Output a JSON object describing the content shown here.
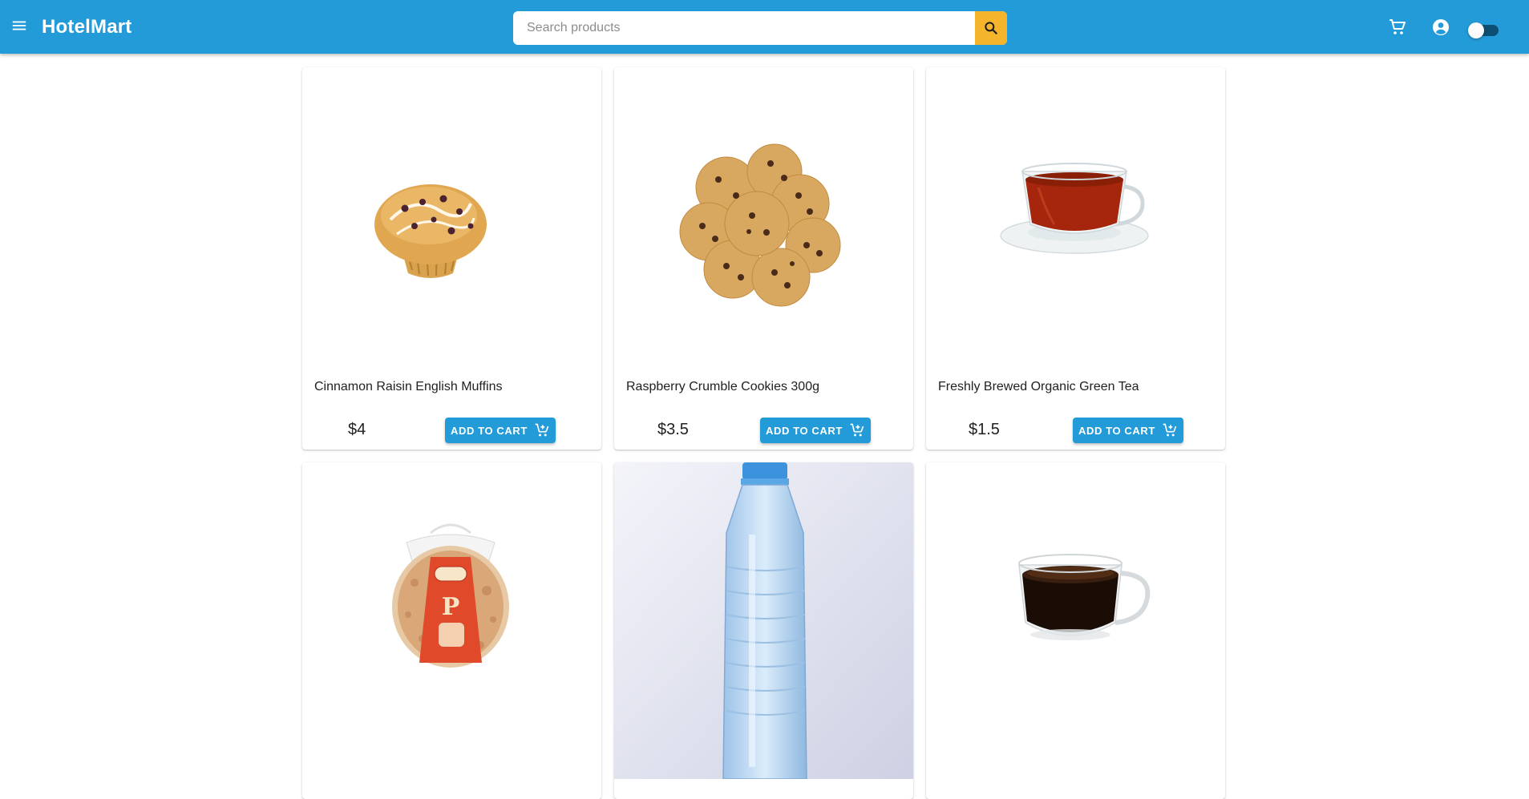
{
  "app": {
    "title": "HotelMart",
    "brand_color": "#229bd8",
    "accent_color": "#f4b52d"
  },
  "header": {
    "menu_icon": "menu-icon",
    "search": {
      "placeholder": "Search products",
      "value": "",
      "icon": "search-icon"
    },
    "cart_icon": "cart-icon",
    "account_icon": "account-circle-icon",
    "theme_toggle": {
      "on": false
    }
  },
  "products": [
    {
      "name": "Cinnamon Raisin English Muffins",
      "price": "$4",
      "button_label": "ADD TO CART",
      "image": "muffin"
    },
    {
      "name": "Raspberry Crumble Cookies 300g",
      "price": "$3.5",
      "button_label": "ADD TO CART",
      "image": "cookies"
    },
    {
      "name": "Freshly Brewed Organic Green Tea",
      "price": "$1.5",
      "button_label": "ADD TO CART",
      "image": "tea-cup"
    },
    {
      "name": "",
      "price": "",
      "button_label": "",
      "image": "pita-bread"
    },
    {
      "name": "",
      "price": "",
      "button_label": "",
      "image": "water-bottle"
    },
    {
      "name": "",
      "price": "",
      "button_label": "",
      "image": "espresso-cup"
    }
  ]
}
